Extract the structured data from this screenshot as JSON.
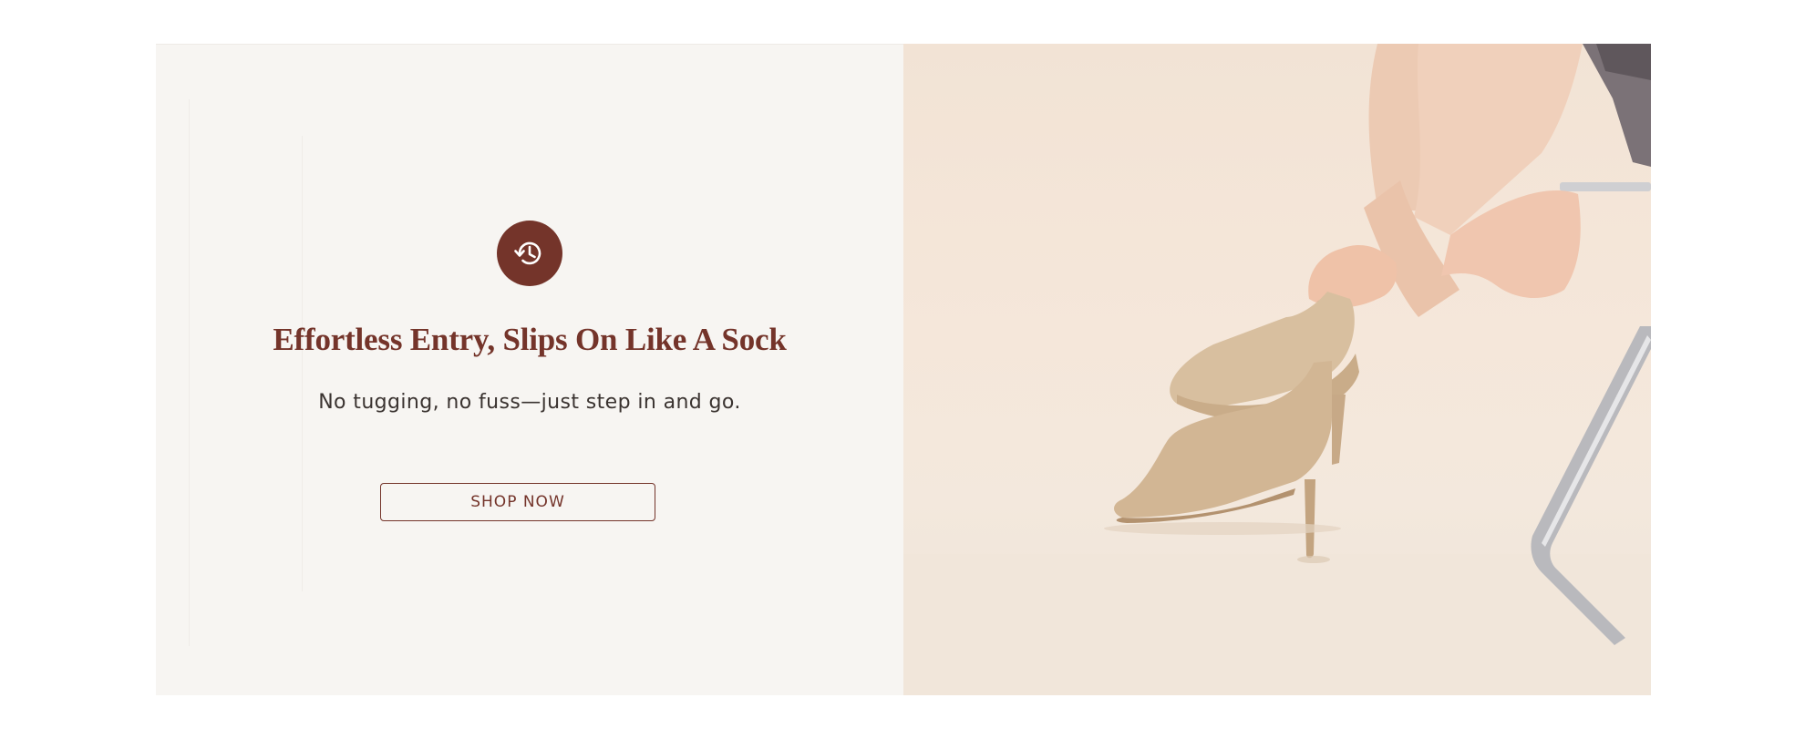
{
  "banner": {
    "badge_icon": "history-clock-icon",
    "headline": "Effortless Entry, Slips On Like A Sock",
    "subline": "No tugging, no fuss—just step in and go.",
    "cta_label": "SHOP NOW",
    "accent_color": "#74342a",
    "image_subject": "woman-pulling-on-beige-knit-sock-boot-photo"
  }
}
